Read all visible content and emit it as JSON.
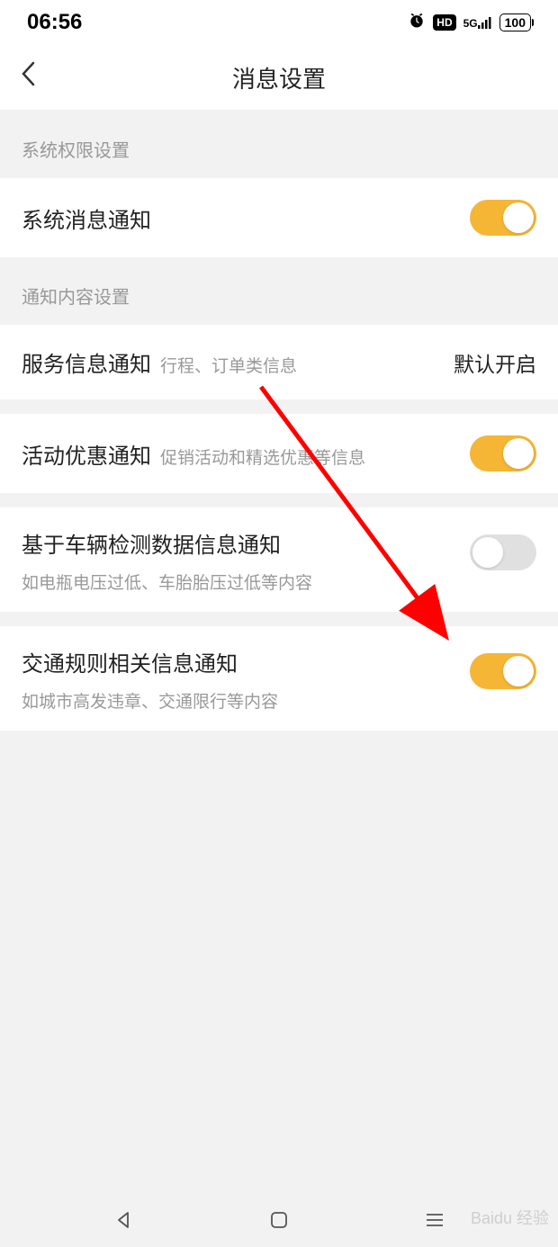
{
  "status": {
    "time": "06:56",
    "network": "5G",
    "battery": "100"
  },
  "nav": {
    "title": "消息设置"
  },
  "sections": [
    {
      "header": "系统权限设置",
      "items": [
        {
          "label": "系统消息通知",
          "type": "toggle",
          "on": true
        }
      ]
    },
    {
      "header": "通知内容设置",
      "items": [
        {
          "label": "服务信息通知",
          "sublabel": "行程、订单类信息",
          "type": "text",
          "value": "默认开启"
        },
        {
          "label": "活动优惠通知",
          "sublabel": "促销活动和精选优惠等信息",
          "type": "toggle",
          "on": true
        },
        {
          "label": "基于车辆检测数据信息通知",
          "desc": "如电瓶电压过低、车胎胎压过低等内容",
          "type": "toggle",
          "on": false
        },
        {
          "label": "交通规则相关信息通知",
          "desc": "如城市高发违章、交通限行等内容",
          "type": "toggle",
          "on": true
        }
      ]
    }
  ],
  "watermark": "Baidu 经验"
}
